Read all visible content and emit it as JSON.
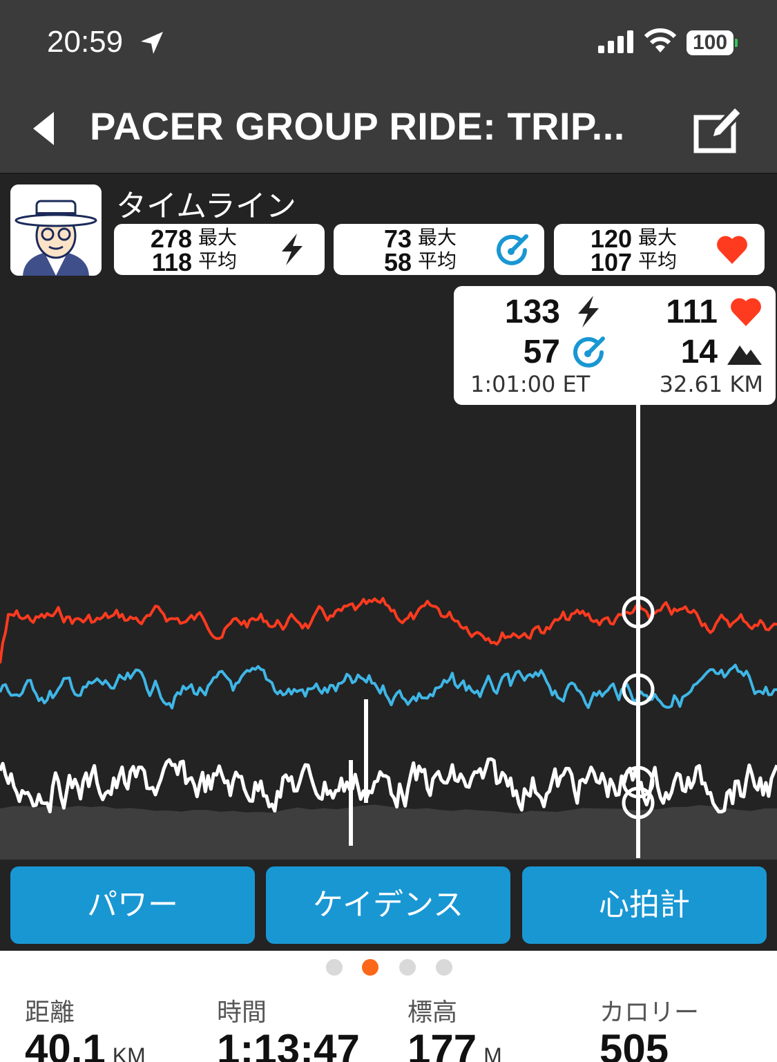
{
  "status": {
    "time": "20:59",
    "battery": "100"
  },
  "header": {
    "title": "PACER GROUP RIDE: TRIP..."
  },
  "timeline_label": "タイムライン",
  "stats": [
    {
      "max": "278",
      "avg": "118",
      "max_label": "最大",
      "avg_label": "平均",
      "icon": "lightning-icon"
    },
    {
      "max": "73",
      "avg": "58",
      "max_label": "最大",
      "avg_label": "平均",
      "icon": "cadence-gauge-icon"
    },
    {
      "max": "120",
      "avg": "107",
      "max_label": "最大",
      "avg_label": "平均",
      "icon": "heart-icon"
    }
  ],
  "tooltip": {
    "power": "133",
    "heart_rate": "111",
    "cadence": "57",
    "elevation": "14",
    "elapsed": "1:01:00 ET",
    "distance": "32.61 KM"
  },
  "chart_colors": {
    "heart_rate": "#ff3b1f",
    "cadence": "#3fb6e6",
    "power": "#ffffff",
    "elevation": "#4a4a4a"
  },
  "tabs": [
    {
      "label": "パワー"
    },
    {
      "label": "ケイデンス"
    },
    {
      "label": "心拍計"
    }
  ],
  "pager": {
    "count": 4,
    "active": 1
  },
  "summary": [
    {
      "label": "距離",
      "value": "40.1",
      "unit": "KM"
    },
    {
      "label": "時間",
      "value": "1:13:47",
      "unit": ""
    },
    {
      "label": "標高",
      "value": "177",
      "unit": "M"
    },
    {
      "label": "カロリー",
      "value": "505",
      "unit": ""
    }
  ]
}
